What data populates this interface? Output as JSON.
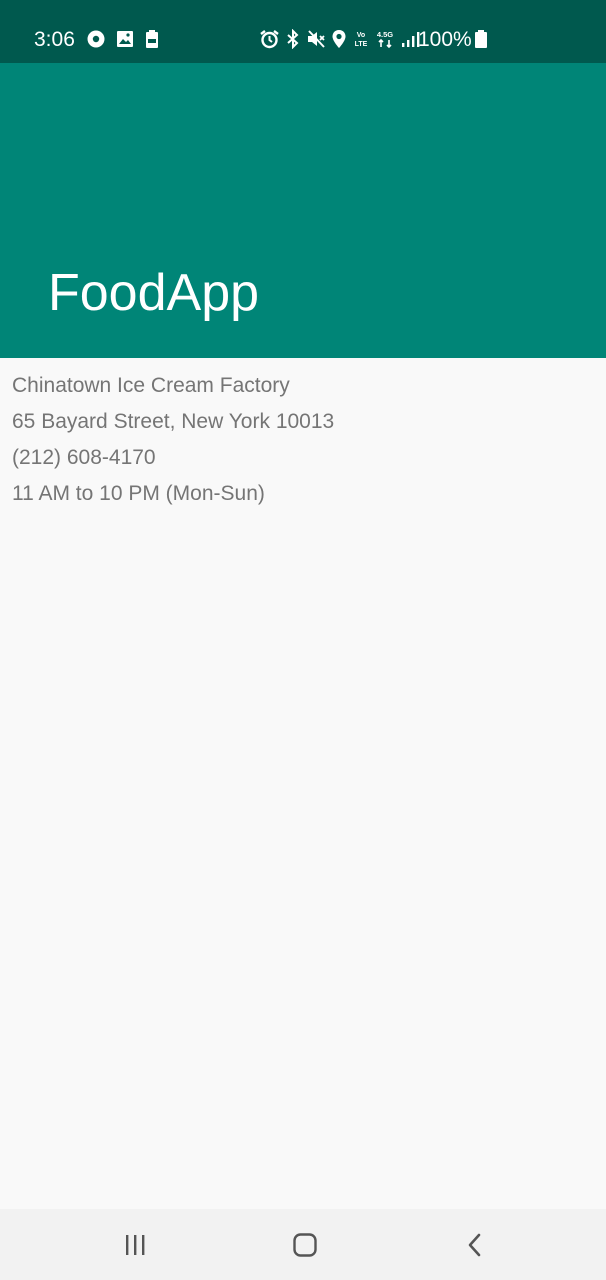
{
  "status_bar": {
    "time": "3:06",
    "battery_percent": "100%",
    "left_icons": [
      "play-circle-icon",
      "image-icon",
      "battery-saver-icon"
    ],
    "right_icons": [
      "alarm-icon",
      "bluetooth-icon",
      "mute-icon",
      "location-icon",
      "volte-icon",
      "4-5g-data-icon",
      "signal-icon",
      "battery-icon"
    ],
    "background_color": "#00594e"
  },
  "app_bar": {
    "title": "FoodApp",
    "background_color": "#008577"
  },
  "restaurant": {
    "name": "Chinatown Ice Cream Factory",
    "address": "65 Bayard Street, New York 10013",
    "phone": "(212) 608-4170",
    "hours": "11 AM to 10 PM (Mon-Sun)"
  },
  "nav_bar": {
    "buttons": [
      "recent-apps-icon",
      "home-icon",
      "back-icon"
    ]
  }
}
